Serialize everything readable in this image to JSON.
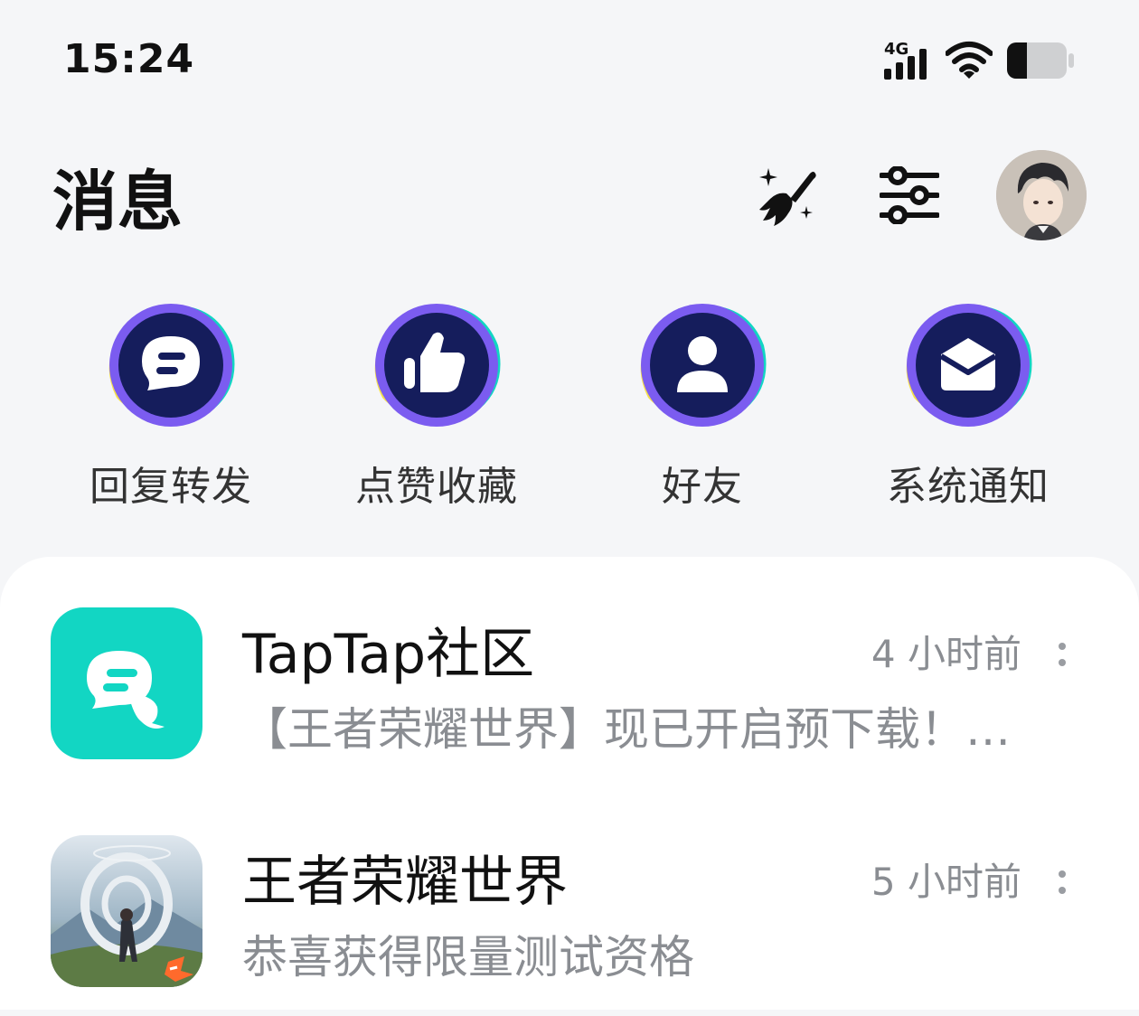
{
  "status_bar": {
    "time": "15:24",
    "network": "4G",
    "icons": [
      "signal-icon",
      "wifi-icon",
      "battery-icon"
    ]
  },
  "header": {
    "title": "消息",
    "actions": [
      "clear-unread-icon",
      "filter-settings-icon",
      "user-avatar"
    ]
  },
  "quick_actions": [
    {
      "label": "回复转发",
      "icon": "chat-bubble-icon"
    },
    {
      "label": "点赞收藏",
      "icon": "thumbs-up-icon"
    },
    {
      "label": "好友",
      "icon": "person-icon"
    },
    {
      "label": "系统通知",
      "icon": "envelope-icon"
    }
  ],
  "messages": [
    {
      "name": "TapTap社区",
      "time": "4 小时前",
      "preview": "【王者荣耀世界】现已开启预下载！…",
      "avatar": "taptap-chat-icon"
    },
    {
      "name": "王者荣耀世界",
      "time": "5 小时前",
      "preview": "恭喜获得限量测试资格",
      "avatar": "game-cover-image"
    }
  ],
  "colors": {
    "background": "#f5f6f8",
    "accent_teal": "#12d6c3",
    "ring_purple": "#7b5cf0",
    "ring_yellow": "#f5e04d",
    "icon_navy": "#151d5c",
    "secondary_text": "#8a8d92"
  }
}
